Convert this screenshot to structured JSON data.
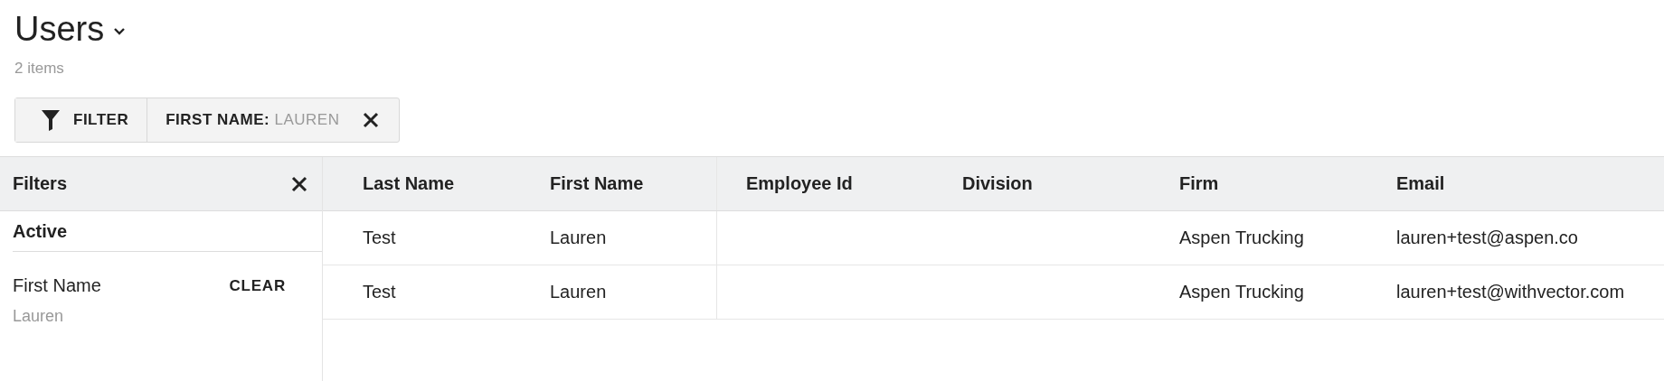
{
  "page": {
    "title": "Users",
    "count": "2 items"
  },
  "filter_bar": {
    "button": "FILTER",
    "chips": [
      {
        "field": "FIRST NAME:",
        "value": "LAUREN"
      }
    ]
  },
  "filters_panel": {
    "title": "Filters",
    "section": "Active",
    "items": [
      {
        "label": "First Name",
        "action": "CLEAR",
        "value": "Lauren"
      }
    ]
  },
  "table": {
    "columns": [
      "Last Name",
      "First Name",
      "Employee Id",
      "Division",
      "Firm",
      "Email"
    ],
    "rows": [
      [
        "Test",
        "Lauren",
        "",
        "",
        "Aspen Trucking",
        "lauren+test@aspen.co"
      ],
      [
        "Test",
        "Lauren",
        "",
        "",
        "Aspen Trucking",
        "lauren+test@withvector.com"
      ]
    ]
  }
}
